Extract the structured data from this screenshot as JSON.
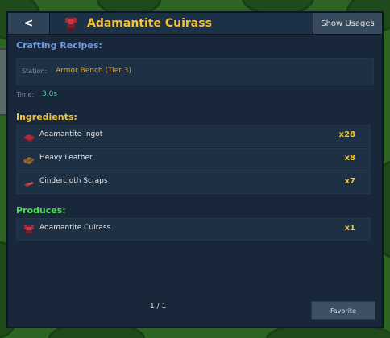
{
  "header": {
    "back_label": "<",
    "title": "Adamantite Cuirass",
    "show_usages_label": "Show Usages"
  },
  "recipe": {
    "section_title": "Crafting Recipes:",
    "station_label": "Station:",
    "station_value": "Armor Bench (Tier 3)",
    "time_label": "Time:",
    "time_value": "3.0s"
  },
  "ingredients": {
    "title": "Ingredients:",
    "items": [
      {
        "name": "Adamantite Ingot",
        "qty": "x28",
        "icon": "ingot-icon"
      },
      {
        "name": "Heavy Leather",
        "qty": "x8",
        "icon": "leather-icon"
      },
      {
        "name": "Cindercloth Scraps",
        "qty": "x7",
        "icon": "cloth-scraps-icon"
      }
    ]
  },
  "produces": {
    "title": "Produces:",
    "items": [
      {
        "name": "Adamantite Cuirass",
        "qty": "x1",
        "icon": "cuirass-icon"
      }
    ]
  },
  "footer": {
    "pager": "1 / 1",
    "favorite_label": "Favorite"
  },
  "colors": {
    "panel_bg": "#18273a",
    "title_gold": "#f4c430",
    "crafting_blue": "#6f9de0",
    "produces_green": "#4ce04c",
    "station_orange": "#e0a030",
    "time_teal": "#4fd1b0"
  }
}
